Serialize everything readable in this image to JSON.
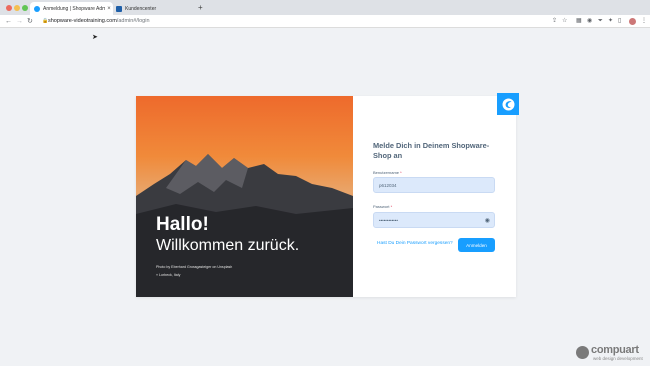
{
  "browser": {
    "tabs": [
      {
        "label": "Anmeldung | Shopware Administr",
        "close": "×"
      },
      {
        "label": "Kundencenter"
      }
    ],
    "new_tab": "+",
    "url_host": "shopware-videotraining.com",
    "url_path": "/admin#/login"
  },
  "hero": {
    "title": "Hallo!",
    "subtitle": "Willkommen zurück.",
    "photo_credit": "Photo by Eberhard Grossgasteiger on Unsplash",
    "location": "Lorbeck, Italy"
  },
  "form": {
    "title": "Melde Dich in Deinem Shopware-Shop an",
    "username_label": "Benutzername",
    "username_value": "p612034",
    "password_label": "Passwort",
    "password_value": "••••••••••••",
    "required_mark": "*",
    "forgot_link": "Hast Du Dein Passwort vergessen?",
    "login_button": "Anmelden"
  },
  "watermark": {
    "name": "compuart",
    "tagline": "web design development"
  },
  "colors": {
    "accent": "#189eff",
    "text": "#52667a",
    "background": "#f0f2f5"
  }
}
